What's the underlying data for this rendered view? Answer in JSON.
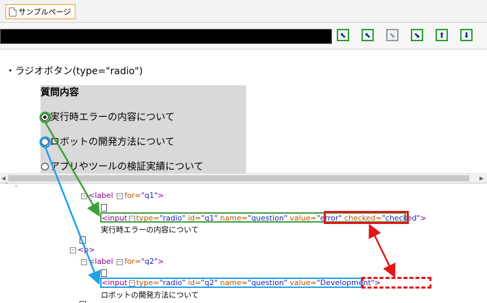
{
  "tab": {
    "title": "サンプルページ"
  },
  "toolbar": {
    "buttons": [
      {
        "name": "expand-all-up-left-icon",
        "glyph": "⬉",
        "enabled": true
      },
      {
        "name": "arrow-up-left-icon",
        "glyph": "⬉",
        "enabled": true
      },
      {
        "name": "arrow-down-right-icon",
        "glyph": "⬊",
        "enabled": false
      },
      {
        "name": "collapse-all-down-right-icon",
        "glyph": "⬊",
        "enabled": true
      },
      {
        "name": "arrow-up-icon",
        "glyph": "⬆",
        "enabled": true
      },
      {
        "name": "arrow-down-icon",
        "glyph": "⬇",
        "enabled": true
      }
    ]
  },
  "page": {
    "heading": "・ラジオボタン(type=\"radio\")",
    "question_title": "質問内容",
    "options": [
      {
        "label": "実行時エラーの内容について",
        "checked": true
      },
      {
        "label": "ロボットの開発方法について",
        "checked": false
      },
      {
        "label": "アプリやツールの検証実績について",
        "checked": false
      }
    ]
  },
  "tree": {
    "label1": {
      "tag": "<label",
      "attr": "for=",
      "val": "\"q1\"",
      "close": ">"
    },
    "input1": {
      "tag": "<input",
      "p1": "type=",
      "v1": "\"radio\"",
      "p2": "id=",
      "v2": "\"q1\"",
      "p3": "name=",
      "v3": "\"question\"",
      "p4": "value=",
      "v4": "\"error\"",
      "p5": "checked=",
      "v5": "\"checked\"",
      "close": ">"
    },
    "text1": "実行時エラーの内容について",
    "p_tag": "<p>",
    "label2": {
      "tag": "<label",
      "attr": "for=",
      "val": "\"q2\"",
      "close": ">"
    },
    "input2": {
      "tag": "<input",
      "p1": "type=",
      "v1": "\"radio\"",
      "p2": "id=",
      "v2": "\"q2\"",
      "p3": "name=",
      "v3": "\"question\"",
      "p4": "value=",
      "v4": "\"Development\"",
      "close": ">"
    },
    "text2": "ロボットの開発方法について"
  },
  "colors": {
    "green": "#3aa03a",
    "blue": "#1ea0e6",
    "red": "#e01818"
  }
}
